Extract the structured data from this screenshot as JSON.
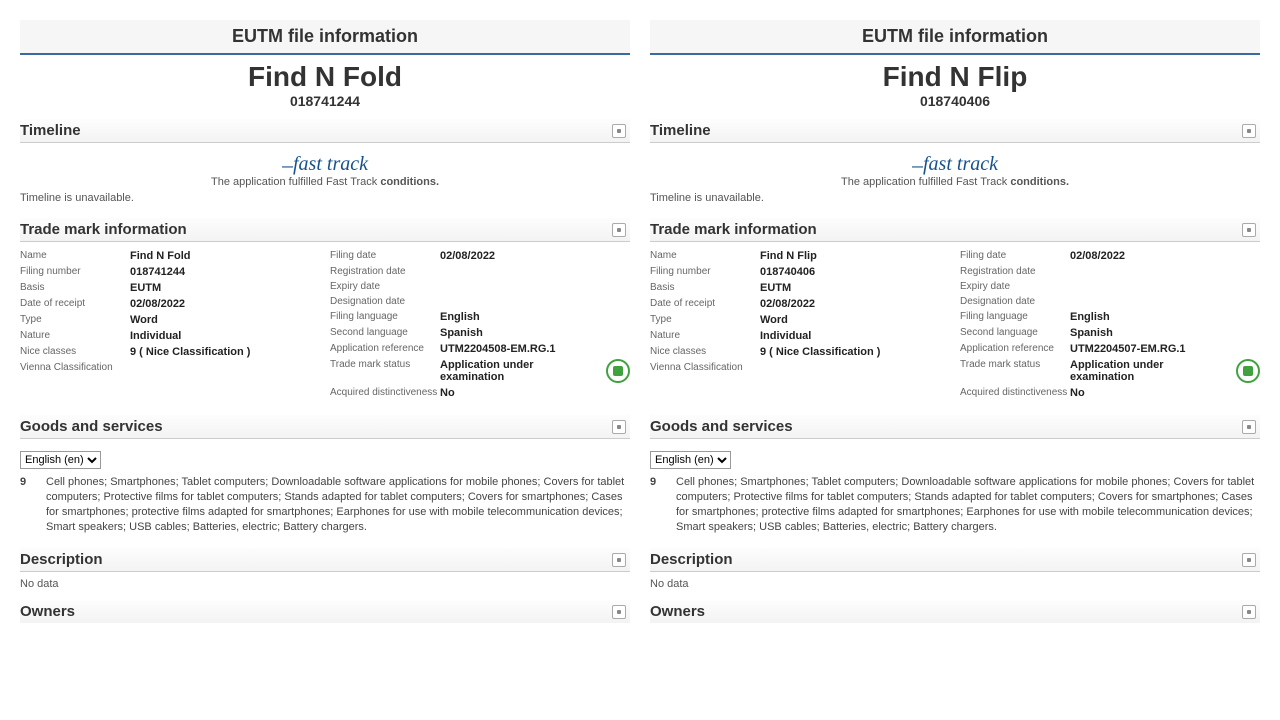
{
  "left": {
    "file_header": "EUTM file information",
    "name": "Find N Fold",
    "number": "018741244",
    "timeline": {
      "title": "Timeline",
      "ft_logo": "fast track",
      "ft_pre": "The application fulfilled Fast Track ",
      "ft_cond": "conditions.",
      "msg": "Timeline is unavailable."
    },
    "tmi": {
      "title": "Trade mark information",
      "left": {
        "name_k": "Name",
        "name_v": "Find N Fold",
        "file_k": "Filing number",
        "file_v": "018741244",
        "basis_k": "Basis",
        "basis_v": "EUTM",
        "dor_k": "Date of receipt",
        "dor_v": "02/08/2022",
        "type_k": "Type",
        "type_v": "Word",
        "nature_k": "Nature",
        "nature_v": "Individual",
        "nice_k": "Nice classes",
        "nice_v": "9 ( Nice Classification )",
        "vienna_k": "Vienna Classification",
        "vienna_v": ""
      },
      "right": {
        "fd_k": "Filing date",
        "fd_v": "02/08/2022",
        "reg_k": "Registration date",
        "reg_v": "",
        "exp_k": "Expiry date",
        "exp_v": "",
        "des_k": "Designation date",
        "des_v": "",
        "flang_k": "Filing language",
        "flang_v": "English",
        "slang_k": "Second language",
        "slang_v": "Spanish",
        "appref_k": "Application reference",
        "appref_v": "UTM2204508-EM.RG.1",
        "status_k": "Trade mark status",
        "status_v": "Application under examination",
        "acq_k": "Acquired distinctiveness",
        "acq_v": "No"
      }
    },
    "gs": {
      "title": "Goods and services",
      "lang": "English (en)",
      "class": "9",
      "text": "Cell phones; Smartphones; Tablet computers; Downloadable software applications for mobile phones; Covers for tablet computers; Protective films for tablet computers; Stands adapted for tablet computers; Covers for smartphones; Cases for smartphones; protective films adapted for smartphones; Earphones for use with mobile telecommunication devices; Smart speakers; USB cables; Batteries, electric; Battery chargers."
    },
    "desc": {
      "title": "Description",
      "no": "No data"
    },
    "owners": {
      "title": "Owners"
    }
  },
  "right": {
    "file_header": "EUTM file information",
    "name": "Find N Flip",
    "number": "018740406",
    "timeline": {
      "title": "Timeline",
      "ft_logo": "fast track",
      "ft_pre": "The application fulfilled Fast Track ",
      "ft_cond": "conditions.",
      "msg": "Timeline is unavailable."
    },
    "tmi": {
      "title": "Trade mark information",
      "left": {
        "name_k": "Name",
        "name_v": "Find N Flip",
        "file_k": "Filing number",
        "file_v": "018740406",
        "basis_k": "Basis",
        "basis_v": "EUTM",
        "dor_k": "Date of receipt",
        "dor_v": "02/08/2022",
        "type_k": "Type",
        "type_v": "Word",
        "nature_k": "Nature",
        "nature_v": "Individual",
        "nice_k": "Nice classes",
        "nice_v": "9 ( Nice Classification )",
        "vienna_k": "Vienna Classification",
        "vienna_v": ""
      },
      "right": {
        "fd_k": "Filing date",
        "fd_v": "02/08/2022",
        "reg_k": "Registration date",
        "reg_v": "",
        "exp_k": "Expiry date",
        "exp_v": "",
        "des_k": "Designation date",
        "des_v": "",
        "flang_k": "Filing language",
        "flang_v": "English",
        "slang_k": "Second language",
        "slang_v": "Spanish",
        "appref_k": "Application reference",
        "appref_v": "UTM2204507-EM.RG.1",
        "status_k": "Trade mark status",
        "status_v": "Application under examination",
        "acq_k": "Acquired distinctiveness",
        "acq_v": "No"
      }
    },
    "gs": {
      "title": "Goods and services",
      "lang": "English (en)",
      "class": "9",
      "text": "Cell phones; Smartphones; Tablet computers; Downloadable software applications for mobile phones; Covers for tablet computers; Protective films for tablet computers; Stands adapted for tablet computers; Covers for smartphones; Cases for smartphones; protective films adapted for smartphones; Earphones for use with mobile telecommunication devices; Smart speakers; USB cables; Batteries, electric; Battery chargers."
    },
    "desc": {
      "title": "Description",
      "no": "No data"
    },
    "owners": {
      "title": "Owners"
    }
  }
}
